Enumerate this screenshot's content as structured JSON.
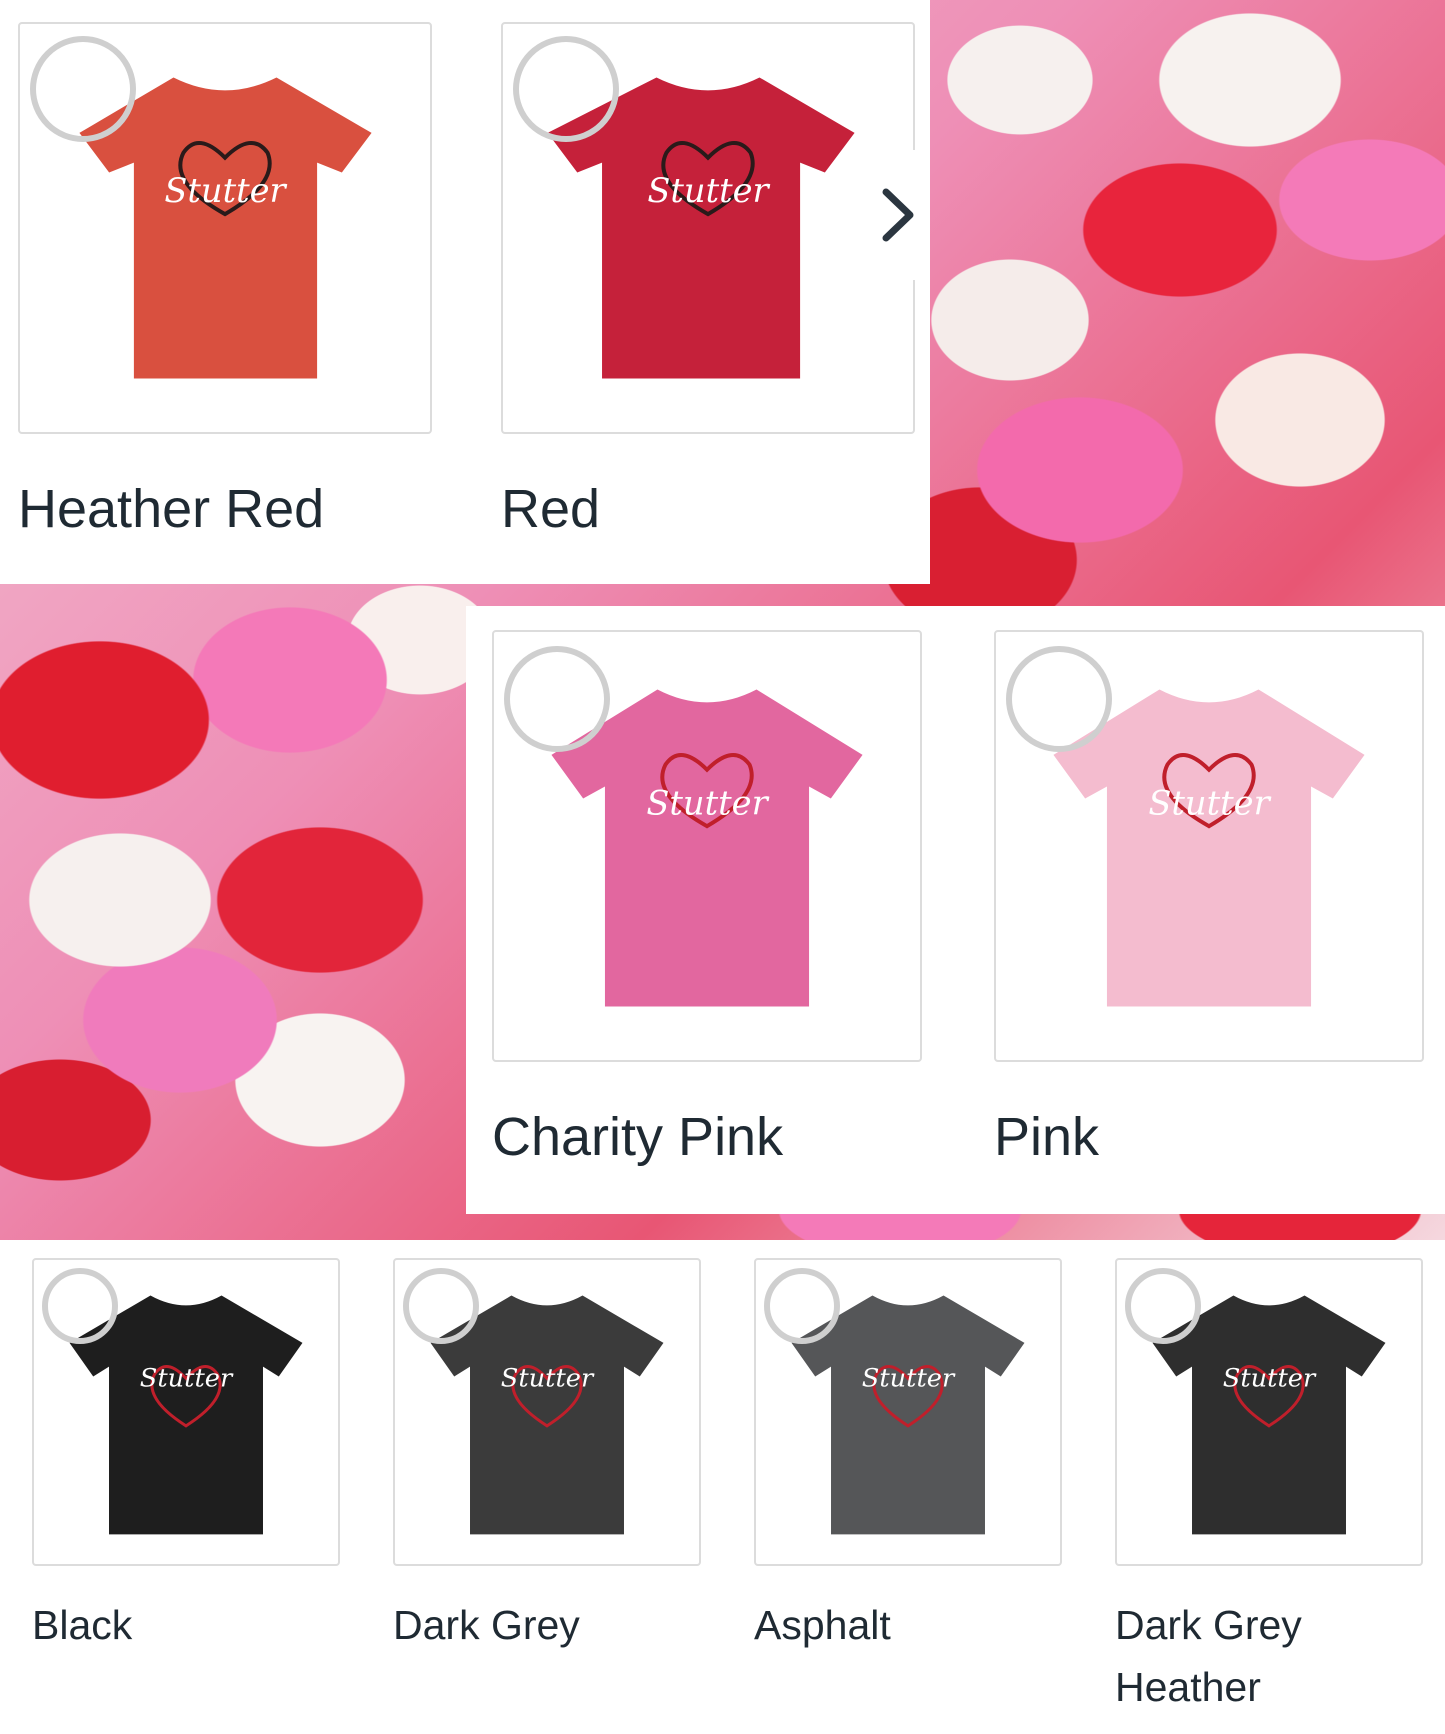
{
  "colors": {
    "heather_red": "#d9503f",
    "red": "#c5213a",
    "charity_pink": "#e2679f",
    "pink": "#f4bccf",
    "black": "#1e1e1e",
    "dark_grey": "#3b3b3b",
    "asphalt": "#555658",
    "dark_grey_heather": "#2e2e2e",
    "heart_dark": "#2a1a1a",
    "heart_red": "#c01f2b"
  },
  "design_text": "Stutter",
  "top_options": [
    {
      "label": "Heather Red",
      "selected": false
    },
    {
      "label": "Red",
      "selected": false
    }
  ],
  "middle_options": [
    {
      "label": "Charity Pink",
      "selected": false
    },
    {
      "label": "Pink",
      "selected": false
    }
  ],
  "bottom_options": [
    {
      "label": "Black",
      "selected": false
    },
    {
      "label": "Dark Grey",
      "selected": false
    },
    {
      "label": "Asphalt",
      "selected": false
    },
    {
      "label": "Dark Grey Heather",
      "selected": false
    }
  ],
  "icons": {
    "next": "chevron-right-icon",
    "radio": "radio-circle-icon"
  }
}
